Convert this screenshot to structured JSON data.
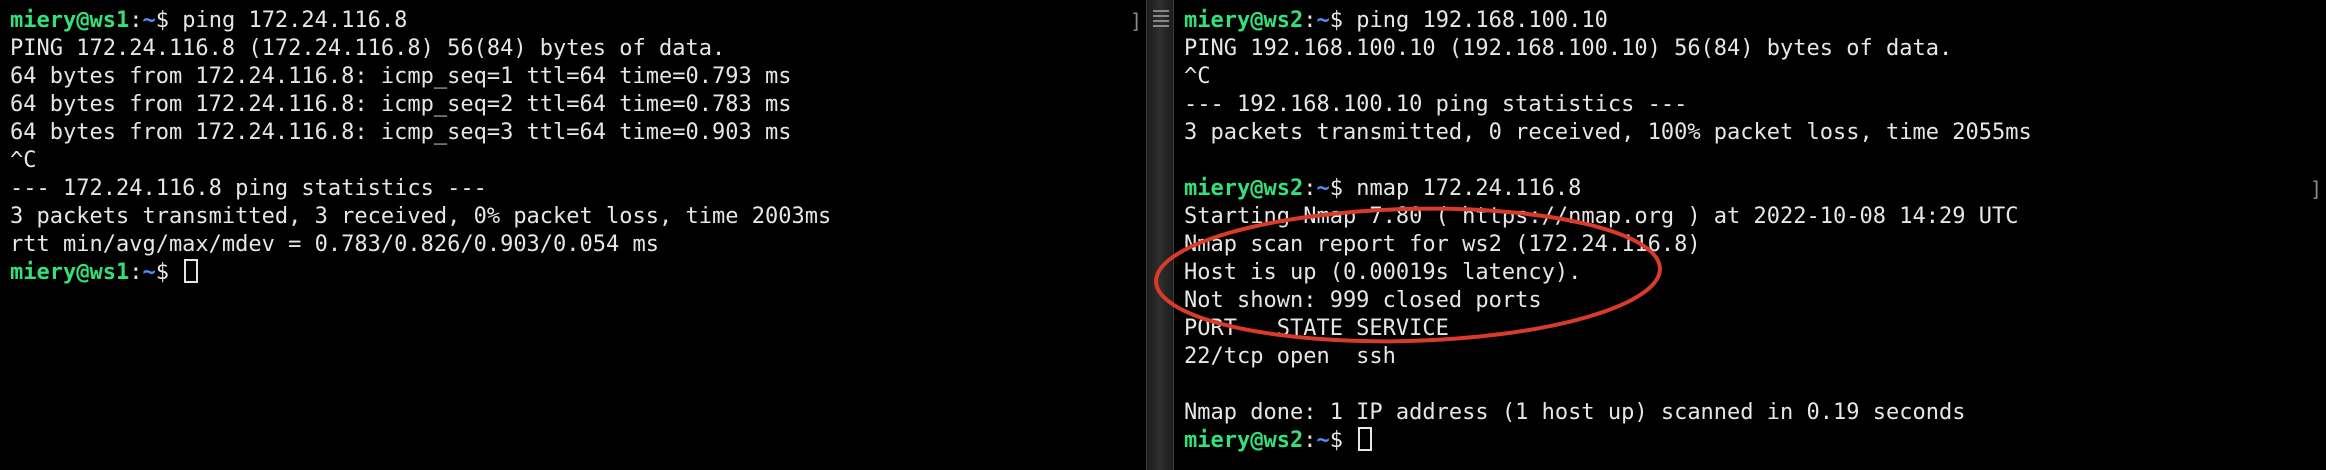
{
  "left_pane": {
    "prompt": {
      "user": "miery@ws1",
      "sep": ":",
      "path": "~",
      "symbol": "$ "
    },
    "command": "ping 172.24.116.8",
    "output": [
      "PING 172.24.116.8 (172.24.116.8) 56(84) bytes of data.",
      "64 bytes from 172.24.116.8: icmp_seq=1 ttl=64 time=0.793 ms",
      "64 bytes from 172.24.116.8: icmp_seq=2 ttl=64 time=0.783 ms",
      "64 bytes from 172.24.116.8: icmp_seq=3 ttl=64 time=0.903 ms",
      "^C",
      "--- 172.24.116.8 ping statistics ---",
      "3 packets transmitted, 3 received, 0% packet loss, time 2003ms",
      "rtt min/avg/max/mdev = 0.783/0.826/0.903/0.054 ms"
    ]
  },
  "right_pane": {
    "prompt": {
      "user": "miery@ws2",
      "sep": ":",
      "path": "~",
      "symbol": "$ "
    },
    "command1": "ping 192.168.100.10",
    "output1": [
      "PING 192.168.100.10 (192.168.100.10) 56(84) bytes of data.",
      "^C",
      "--- 192.168.100.10 ping statistics ---",
      "3 packets transmitted, 0 received, 100% packet loss, time 2055ms"
    ],
    "command2": "nmap 172.24.116.8",
    "output2": [
      "Starting Nmap 7.80 ( https://nmap.org ) at 2022-10-08 14:29 UTC",
      "Nmap scan report for ws2 (172.24.116.8)",
      "Host is up (0.00019s latency).",
      "Not shown: 999 closed ports",
      "PORT   STATE SERVICE",
      "22/tcp open  ssh",
      "",
      "Nmap done: 1 IP address (1 host up) scanned in 0.19 seconds"
    ]
  },
  "bracket_glyph": "]",
  "annotation_color": "#d93b2b"
}
